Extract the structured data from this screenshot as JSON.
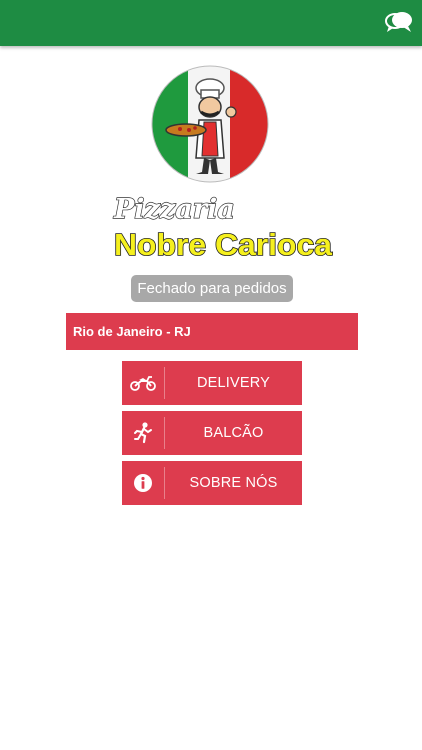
{
  "header": {
    "chat_icon": "chat-bubbles-icon",
    "background": "#1e8c43"
  },
  "logo": {
    "line1": "Pizzaria",
    "line2": "Nobre Carioca"
  },
  "status": {
    "text": "Fechado para pedidos"
  },
  "location": {
    "selected": "Rio de Janeiro - RJ"
  },
  "menu": [
    {
      "label": "DELIVERY",
      "icon": "motorcycle-icon"
    },
    {
      "label": "BALCÃO",
      "icon": "running-person-icon"
    },
    {
      "label": "SOBRE NÓS",
      "icon": "info-icon"
    }
  ],
  "colors": {
    "accent": "#dd3c4e",
    "badge": "#a8a8a8"
  }
}
